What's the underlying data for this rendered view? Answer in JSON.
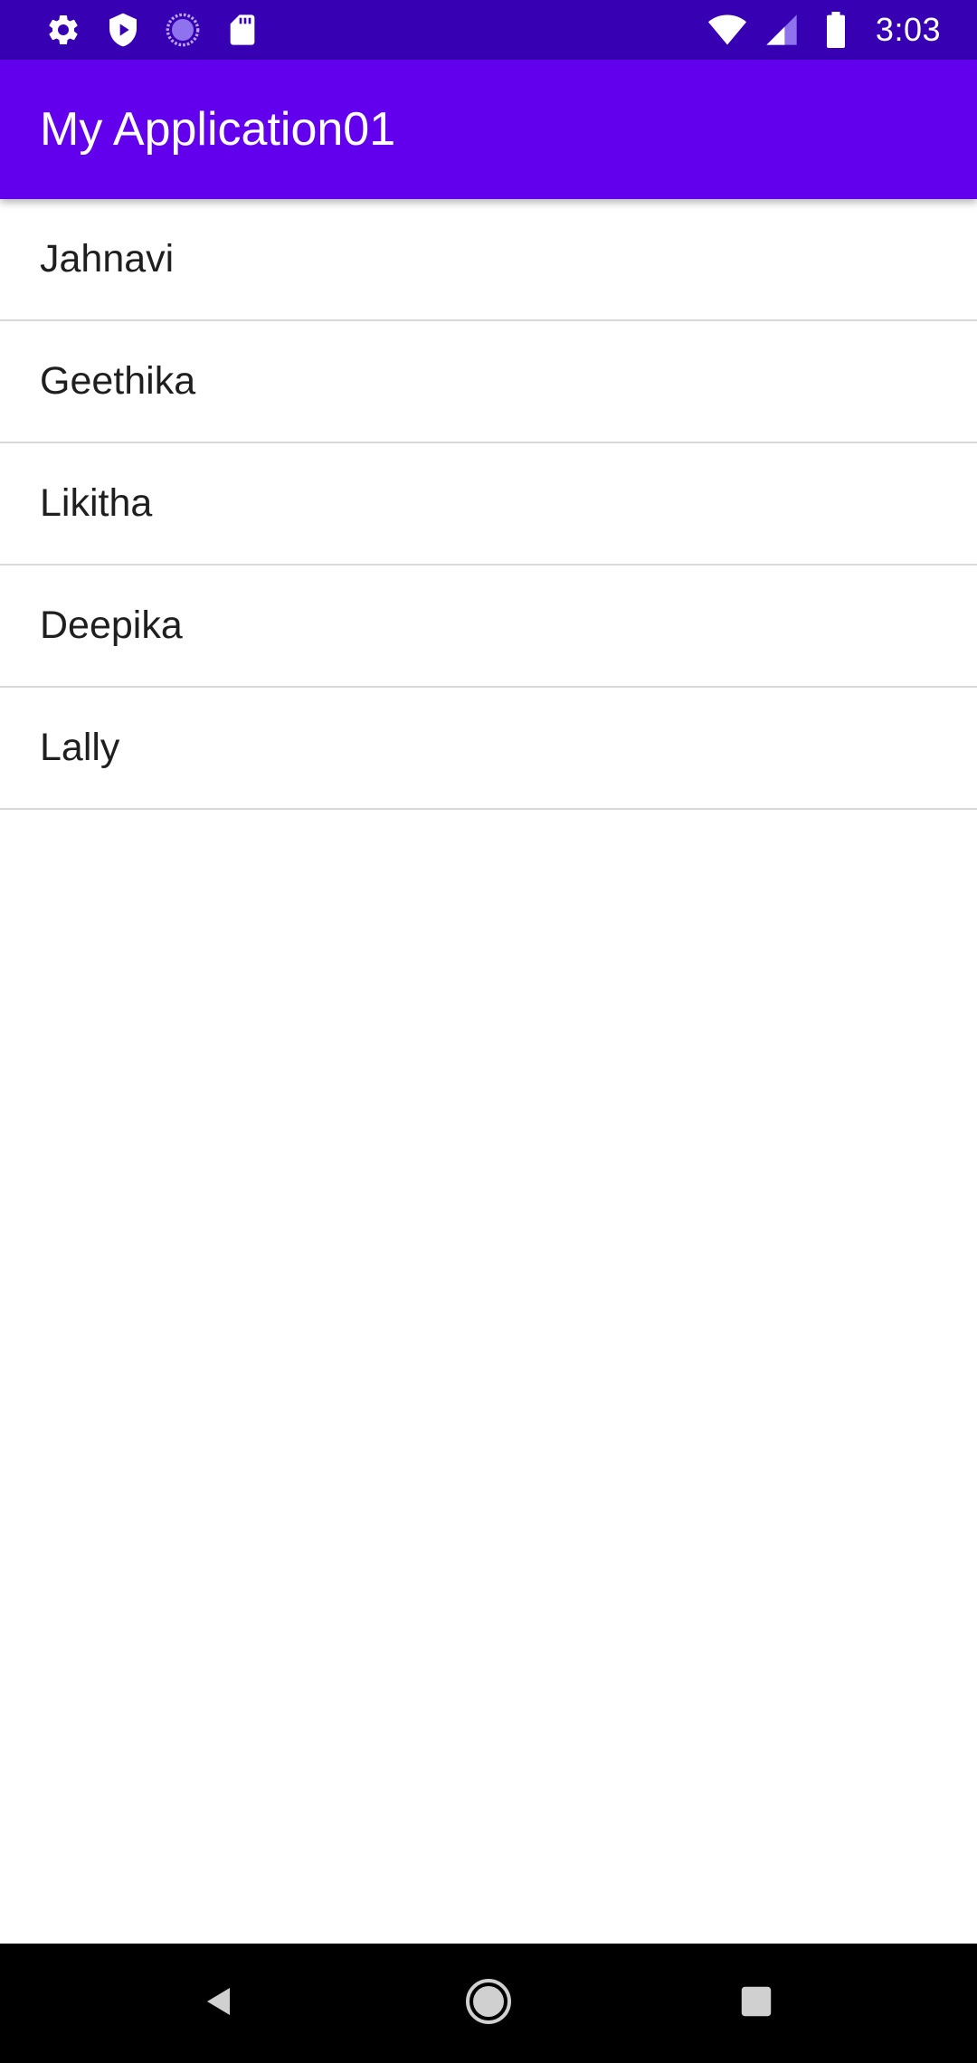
{
  "status_bar": {
    "time": "3:03",
    "left_icons": [
      "settings-icon",
      "shield-play-icon",
      "sync-circle-icon",
      "sd-card-icon"
    ],
    "right_icons": [
      "wifi-icon",
      "cell-signal-icon",
      "battery-icon"
    ],
    "colors": {
      "background": "#3700b3",
      "foreground": "#ffffff"
    }
  },
  "app_bar": {
    "title": "My Application01",
    "color": "#6200ee"
  },
  "list": {
    "items": [
      {
        "label": "Jahnavi"
      },
      {
        "label": "Geethika"
      },
      {
        "label": "Likitha"
      },
      {
        "label": "Deepika"
      },
      {
        "label": "Lally"
      }
    ]
  },
  "nav_bar": {
    "buttons": [
      "back-icon",
      "home-icon",
      "recents-icon"
    ],
    "color": "#000000"
  }
}
